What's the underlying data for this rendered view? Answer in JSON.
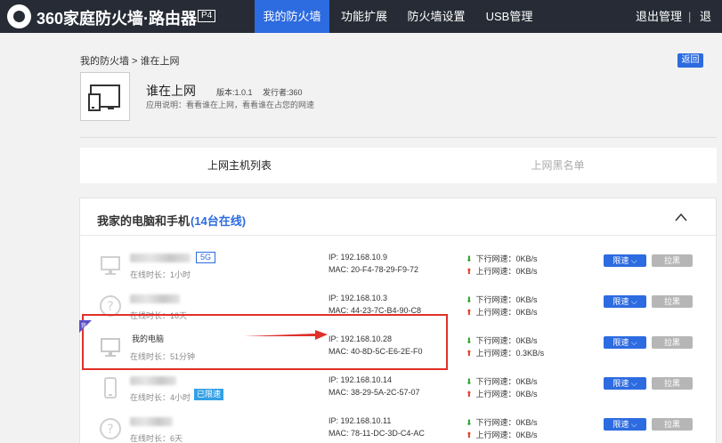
{
  "topbar": {
    "brand": "360家庭防火墙·路由器",
    "badge": "P4",
    "tabs": [
      {
        "label": "我的防火墙",
        "active": true
      },
      {
        "label": "功能扩展",
        "active": false
      },
      {
        "label": "防火墙设置",
        "active": false
      },
      {
        "label": "USB管理",
        "active": false
      }
    ],
    "logout": "退出管理",
    "separator": "|",
    "exit": "退"
  },
  "breadcrumb": "我的防火墙 > 谁在上网",
  "back_label": "返回",
  "app": {
    "title": "谁在上网",
    "version": "版本:1.0.1",
    "publisher": "发行者:360",
    "description": "应用说明：看看谁在上网，看看谁在占您的网速",
    "icon": "monitor-phone-icon"
  },
  "list_tabs": [
    {
      "label": "上网主机列表",
      "active": true
    },
    {
      "label": "上网黑名单",
      "active": false
    }
  ],
  "devices_section": {
    "title": "我家的电脑和手机",
    "count": "(14台在线)"
  },
  "devices": [
    {
      "name": "",
      "band": "5G",
      "online": "在线时长：1小时",
      "limited": "",
      "ip": "IP: 192.168.10.9",
      "mac": "MAC: 20-F4-78-29-F9-72",
      "down": "下行网速：0KB/s",
      "up": "上行网速：0KB/s",
      "icon": "desktop-icon"
    },
    {
      "name": "",
      "band": "",
      "online": "在线时长：16天",
      "limited": "",
      "ip": "IP: 192.168.10.3",
      "mac": "MAC: 44-23-7C-B4-90-C8",
      "down": "下行网速：0KB/s",
      "up": "上行网速：0KB/s",
      "icon": "unknown-device-icon"
    },
    {
      "name": "我的电脑",
      "band": "",
      "online": "在线时长：51分钟",
      "limited": "",
      "ip": "IP: 192.168.10.28",
      "mac": "MAC: 40-8D-5C-E6-2E-F0",
      "down": "下行网速：0KB/s",
      "up": "上行网速：0.3KB/s",
      "icon": "desktop-icon"
    },
    {
      "name": "",
      "band": "",
      "online": "在线时长：4小时",
      "limited": "已限速",
      "ip": "IP: 192.168.10.14",
      "mac": "MAC: 38-29-5A-2C-57-07",
      "down": "下行网速：0KB/s",
      "up": "上行网速：0KB/s",
      "icon": "phone-icon"
    },
    {
      "name": "",
      "band": "",
      "online": "在线时长：6天",
      "limited": "",
      "ip": "IP: 192.168.10.11",
      "mac": "MAC: 78-11-DC-3D-C4-AC",
      "down": "下行网速：0KB/s",
      "up": "上行网速：0KB/s",
      "icon": "unknown-device-icon"
    }
  ],
  "row_actions": {
    "limit": "限速",
    "block": "拉黑"
  },
  "corner_badge": "我",
  "colors": {
    "topbar": "#262b35",
    "accent": "#2d6be0",
    "highlight": "#e0302a",
    "down_arrow": "#2aa52a",
    "up_arrow": "#e2412b"
  }
}
